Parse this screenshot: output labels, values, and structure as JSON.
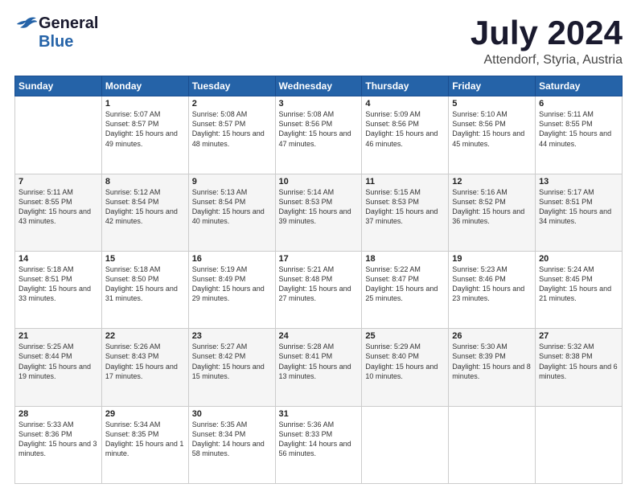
{
  "header": {
    "logo_general": "General",
    "logo_blue": "Blue",
    "title": "July 2024",
    "subtitle": "Attendorf, Styria, Austria"
  },
  "calendar": {
    "weekdays": [
      "Sunday",
      "Monday",
      "Tuesday",
      "Wednesday",
      "Thursday",
      "Friday",
      "Saturday"
    ],
    "weeks": [
      [
        {
          "day": "",
          "sunrise": "",
          "sunset": "",
          "daylight": ""
        },
        {
          "day": "1",
          "sunrise": "Sunrise: 5:07 AM",
          "sunset": "Sunset: 8:57 PM",
          "daylight": "Daylight: 15 hours and 49 minutes."
        },
        {
          "day": "2",
          "sunrise": "Sunrise: 5:08 AM",
          "sunset": "Sunset: 8:57 PM",
          "daylight": "Daylight: 15 hours and 48 minutes."
        },
        {
          "day": "3",
          "sunrise": "Sunrise: 5:08 AM",
          "sunset": "Sunset: 8:56 PM",
          "daylight": "Daylight: 15 hours and 47 minutes."
        },
        {
          "day": "4",
          "sunrise": "Sunrise: 5:09 AM",
          "sunset": "Sunset: 8:56 PM",
          "daylight": "Daylight: 15 hours and 46 minutes."
        },
        {
          "day": "5",
          "sunrise": "Sunrise: 5:10 AM",
          "sunset": "Sunset: 8:56 PM",
          "daylight": "Daylight: 15 hours and 45 minutes."
        },
        {
          "day": "6",
          "sunrise": "Sunrise: 5:11 AM",
          "sunset": "Sunset: 8:55 PM",
          "daylight": "Daylight: 15 hours and 44 minutes."
        }
      ],
      [
        {
          "day": "7",
          "sunrise": "Sunrise: 5:11 AM",
          "sunset": "Sunset: 8:55 PM",
          "daylight": "Daylight: 15 hours and 43 minutes."
        },
        {
          "day": "8",
          "sunrise": "Sunrise: 5:12 AM",
          "sunset": "Sunset: 8:54 PM",
          "daylight": "Daylight: 15 hours and 42 minutes."
        },
        {
          "day": "9",
          "sunrise": "Sunrise: 5:13 AM",
          "sunset": "Sunset: 8:54 PM",
          "daylight": "Daylight: 15 hours and 40 minutes."
        },
        {
          "day": "10",
          "sunrise": "Sunrise: 5:14 AM",
          "sunset": "Sunset: 8:53 PM",
          "daylight": "Daylight: 15 hours and 39 minutes."
        },
        {
          "day": "11",
          "sunrise": "Sunrise: 5:15 AM",
          "sunset": "Sunset: 8:53 PM",
          "daylight": "Daylight: 15 hours and 37 minutes."
        },
        {
          "day": "12",
          "sunrise": "Sunrise: 5:16 AM",
          "sunset": "Sunset: 8:52 PM",
          "daylight": "Daylight: 15 hours and 36 minutes."
        },
        {
          "day": "13",
          "sunrise": "Sunrise: 5:17 AM",
          "sunset": "Sunset: 8:51 PM",
          "daylight": "Daylight: 15 hours and 34 minutes."
        }
      ],
      [
        {
          "day": "14",
          "sunrise": "Sunrise: 5:18 AM",
          "sunset": "Sunset: 8:51 PM",
          "daylight": "Daylight: 15 hours and 33 minutes."
        },
        {
          "day": "15",
          "sunrise": "Sunrise: 5:18 AM",
          "sunset": "Sunset: 8:50 PM",
          "daylight": "Daylight: 15 hours and 31 minutes."
        },
        {
          "day": "16",
          "sunrise": "Sunrise: 5:19 AM",
          "sunset": "Sunset: 8:49 PM",
          "daylight": "Daylight: 15 hours and 29 minutes."
        },
        {
          "day": "17",
          "sunrise": "Sunrise: 5:21 AM",
          "sunset": "Sunset: 8:48 PM",
          "daylight": "Daylight: 15 hours and 27 minutes."
        },
        {
          "day": "18",
          "sunrise": "Sunrise: 5:22 AM",
          "sunset": "Sunset: 8:47 PM",
          "daylight": "Daylight: 15 hours and 25 minutes."
        },
        {
          "day": "19",
          "sunrise": "Sunrise: 5:23 AM",
          "sunset": "Sunset: 8:46 PM",
          "daylight": "Daylight: 15 hours and 23 minutes."
        },
        {
          "day": "20",
          "sunrise": "Sunrise: 5:24 AM",
          "sunset": "Sunset: 8:45 PM",
          "daylight": "Daylight: 15 hours and 21 minutes."
        }
      ],
      [
        {
          "day": "21",
          "sunrise": "Sunrise: 5:25 AM",
          "sunset": "Sunset: 8:44 PM",
          "daylight": "Daylight: 15 hours and 19 minutes."
        },
        {
          "day": "22",
          "sunrise": "Sunrise: 5:26 AM",
          "sunset": "Sunset: 8:43 PM",
          "daylight": "Daylight: 15 hours and 17 minutes."
        },
        {
          "day": "23",
          "sunrise": "Sunrise: 5:27 AM",
          "sunset": "Sunset: 8:42 PM",
          "daylight": "Daylight: 15 hours and 15 minutes."
        },
        {
          "day": "24",
          "sunrise": "Sunrise: 5:28 AM",
          "sunset": "Sunset: 8:41 PM",
          "daylight": "Daylight: 15 hours and 13 minutes."
        },
        {
          "day": "25",
          "sunrise": "Sunrise: 5:29 AM",
          "sunset": "Sunset: 8:40 PM",
          "daylight": "Daylight: 15 hours and 10 minutes."
        },
        {
          "day": "26",
          "sunrise": "Sunrise: 5:30 AM",
          "sunset": "Sunset: 8:39 PM",
          "daylight": "Daylight: 15 hours and 8 minutes."
        },
        {
          "day": "27",
          "sunrise": "Sunrise: 5:32 AM",
          "sunset": "Sunset: 8:38 PM",
          "daylight": "Daylight: 15 hours and 6 minutes."
        }
      ],
      [
        {
          "day": "28",
          "sunrise": "Sunrise: 5:33 AM",
          "sunset": "Sunset: 8:36 PM",
          "daylight": "Daylight: 15 hours and 3 minutes."
        },
        {
          "day": "29",
          "sunrise": "Sunrise: 5:34 AM",
          "sunset": "Sunset: 8:35 PM",
          "daylight": "Daylight: 15 hours and 1 minute."
        },
        {
          "day": "30",
          "sunrise": "Sunrise: 5:35 AM",
          "sunset": "Sunset: 8:34 PM",
          "daylight": "Daylight: 14 hours and 58 minutes."
        },
        {
          "day": "31",
          "sunrise": "Sunrise: 5:36 AM",
          "sunset": "Sunset: 8:33 PM",
          "daylight": "Daylight: 14 hours and 56 minutes."
        },
        {
          "day": "",
          "sunrise": "",
          "sunset": "",
          "daylight": ""
        },
        {
          "day": "",
          "sunrise": "",
          "sunset": "",
          "daylight": ""
        },
        {
          "day": "",
          "sunrise": "",
          "sunset": "",
          "daylight": ""
        }
      ]
    ]
  }
}
